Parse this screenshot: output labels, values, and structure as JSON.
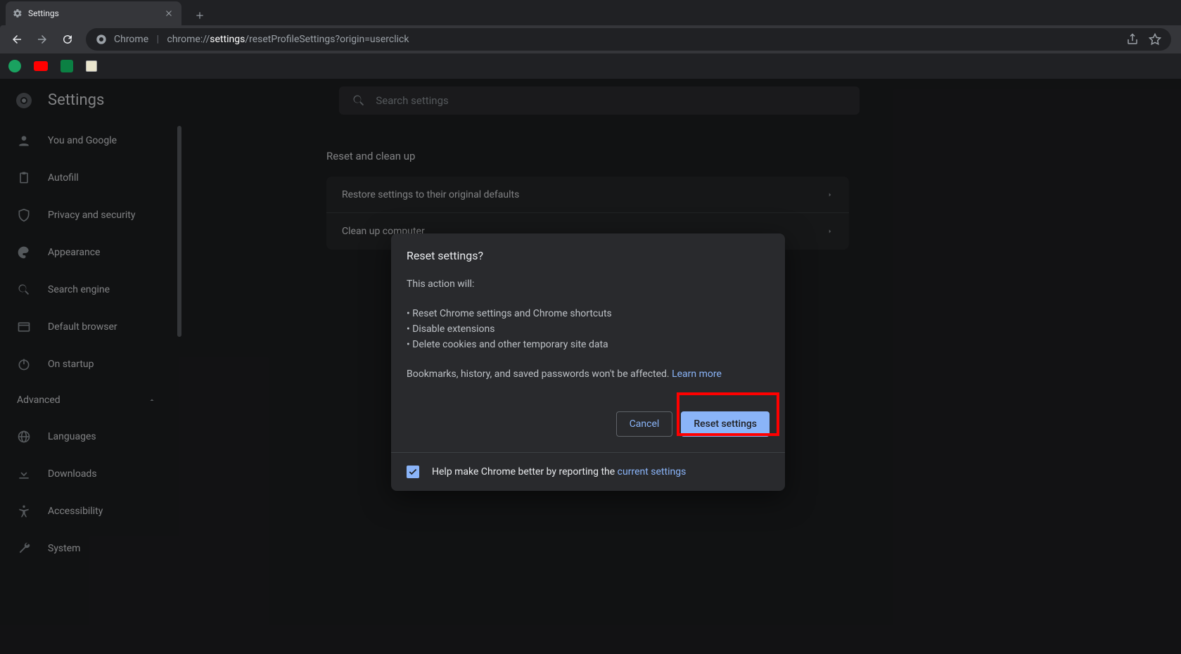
{
  "tab": {
    "title": "Settings"
  },
  "omnibox": {
    "label": "Chrome",
    "url_prefix": "chrome://",
    "url_bold": "settings",
    "url_suffix": "/resetProfileSettings?origin=userclick"
  },
  "settings_title": "Settings",
  "search_placeholder": "Search settings",
  "sidebar": {
    "items": [
      {
        "icon": "person-icon",
        "label": "You and Google"
      },
      {
        "icon": "clipboard-icon",
        "label": "Autofill"
      },
      {
        "icon": "shield-icon",
        "label": "Privacy and security"
      },
      {
        "icon": "palette-icon",
        "label": "Appearance"
      },
      {
        "icon": "search-icon",
        "label": "Search engine"
      },
      {
        "icon": "window-icon",
        "label": "Default browser"
      },
      {
        "icon": "power-icon",
        "label": "On startup"
      }
    ],
    "advanced_label": "Advanced",
    "advanced_items": [
      {
        "icon": "globe-icon",
        "label": "Languages"
      },
      {
        "icon": "download-icon",
        "label": "Downloads"
      },
      {
        "icon": "accessibility-icon",
        "label": "Accessibility"
      },
      {
        "icon": "wrench-icon",
        "label": "System"
      }
    ]
  },
  "main": {
    "section_title": "Reset and clean up",
    "rows": [
      "Restore settings to their original defaults",
      "Clean up computer"
    ]
  },
  "dialog": {
    "title": "Reset settings?",
    "intro": "This action will:",
    "bullets": [
      "Reset Chrome settings and Chrome shortcuts",
      "Disable extensions",
      "Delete cookies and other temporary site data"
    ],
    "footer_text": "Bookmarks, history, and saved passwords won't be affected. ",
    "learn_more": "Learn more",
    "cancel": "Cancel",
    "confirm": "Reset settings",
    "help_text": "Help make Chrome better by reporting the ",
    "help_link": "current settings",
    "help_checked": true
  },
  "bookmarks": [
    {
      "name": "green-circle-icon",
      "color": "#1aa260"
    },
    {
      "name": "youtube-icon",
      "color": "#ff0000"
    },
    {
      "name": "green-square-icon",
      "color": "#0b8043"
    },
    {
      "name": "goodreads-icon",
      "color": "#e9e5cd"
    }
  ]
}
